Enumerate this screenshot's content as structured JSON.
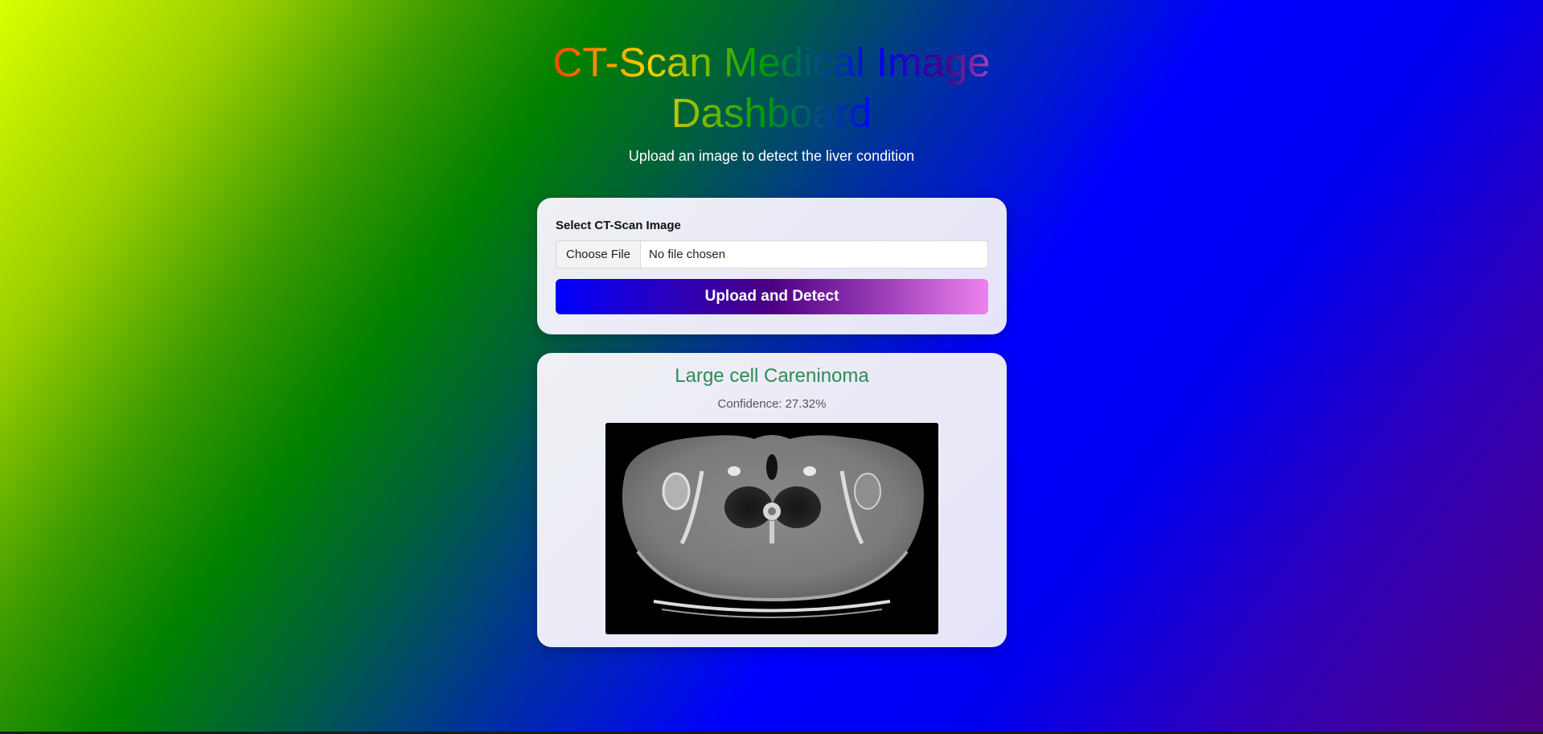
{
  "header": {
    "title": "CT-Scan Medical Image Dashboard",
    "subtitle": "Upload an image to detect the liver condition"
  },
  "upload_form": {
    "label": "Select CT-Scan Image",
    "choose_file_label": "Choose File",
    "file_status": "No file chosen",
    "submit_label": "Upload and Detect"
  },
  "result": {
    "prediction": "Large cell Careninoma",
    "confidence_label": "Confidence:",
    "confidence_value": "27.32%"
  },
  "colors": {
    "prediction_text": "#2e8b57",
    "button_gradient_start": "#0000ff",
    "button_gradient_end": "#ee82ee"
  }
}
